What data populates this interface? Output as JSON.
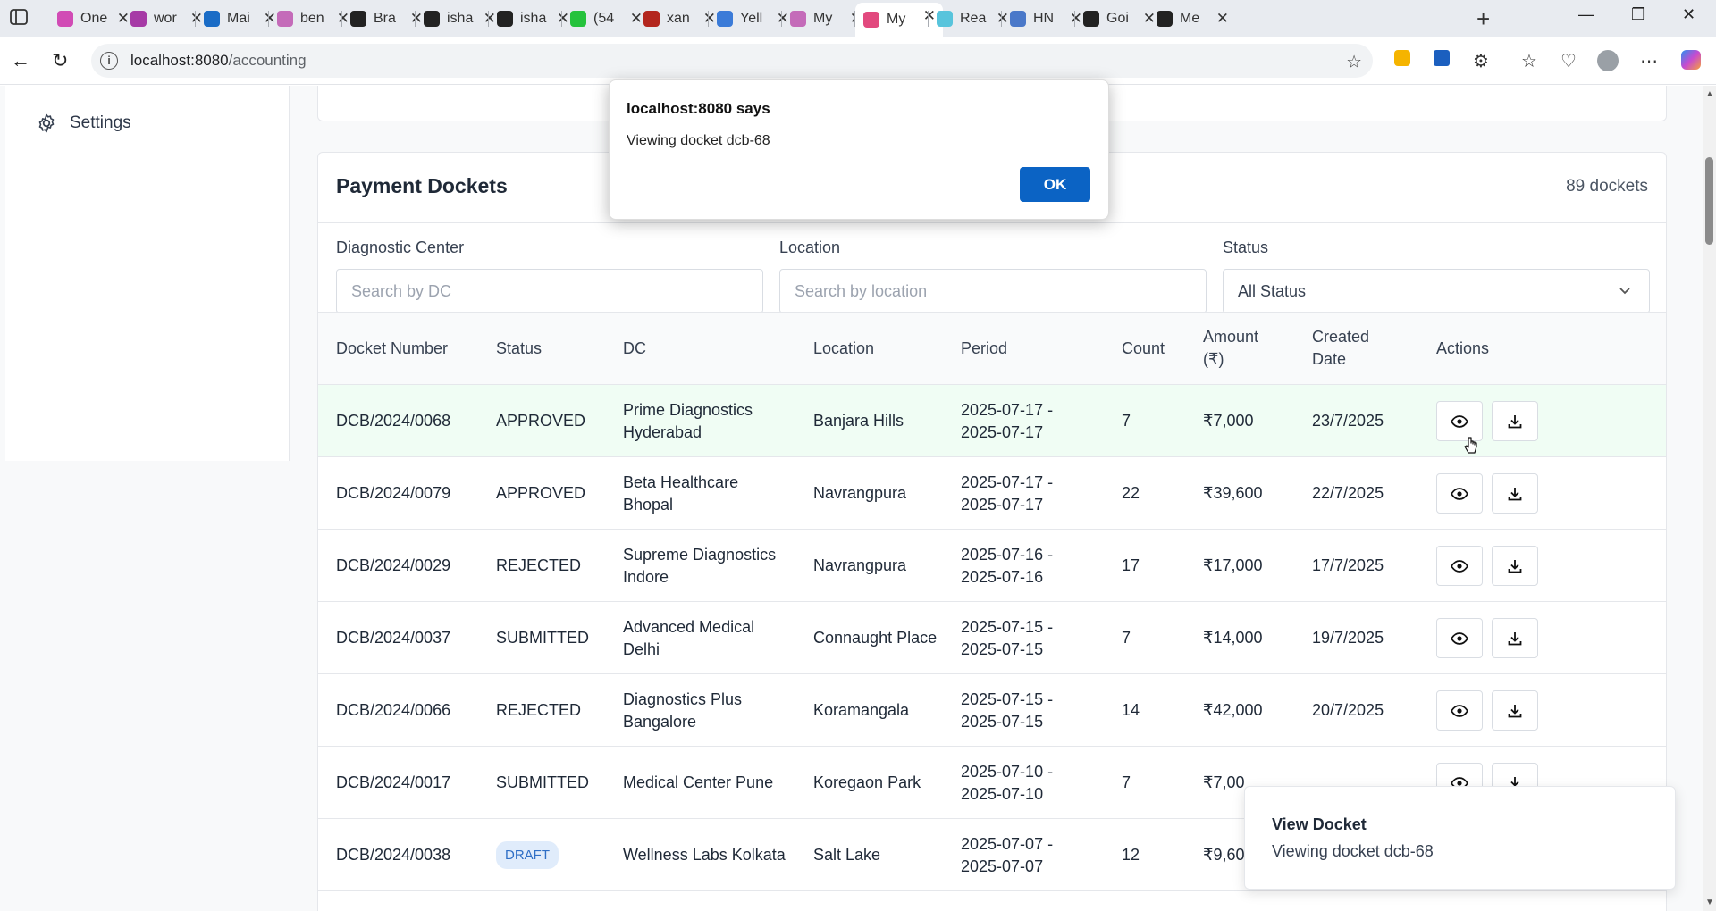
{
  "browser": {
    "tabs": [
      {
        "label": "One",
        "color": "#d14bb5",
        "icon": "copilot-icon"
      },
      {
        "label": "wor",
        "color": "#a63aa6",
        "icon": "onenote-icon"
      },
      {
        "label": "Mai",
        "color": "#1a6cc6",
        "icon": "outlook-icon"
      },
      {
        "label": "ben",
        "color": "#c46bb9",
        "icon": "loop-icon"
      },
      {
        "label": "Bra",
        "color": "#222222",
        "icon": "github-icon"
      },
      {
        "label": "isha",
        "color": "#222222",
        "icon": "github-icon"
      },
      {
        "label": "isha",
        "color": "#222222",
        "icon": "github-icon"
      },
      {
        "label": "(54",
        "color": "#25c23c",
        "icon": "whatsapp-icon"
      },
      {
        "label": "xan",
        "color": "#b3261e",
        "icon": "pdf-icon"
      },
      {
        "label": "Yell",
        "color": "#3b7bd8",
        "icon": "search-icon"
      },
      {
        "label": "My",
        "color": "#c46bb9",
        "icon": "loop-icon"
      },
      {
        "label": "My",
        "color": "#e2497e",
        "icon": "app-icon",
        "active": true
      },
      {
        "label": "Rea",
        "color": "#58c4dc",
        "icon": "react-icon"
      },
      {
        "label": "HN",
        "color": "#4a78c9",
        "icon": "hn-icon"
      },
      {
        "label": "Goi",
        "color": "#222222",
        "icon": "github-icon"
      },
      {
        "label": "Me",
        "color": "#222222",
        "icon": "openai-icon"
      }
    ],
    "url_host": "localhost:8080",
    "url_path": "/accounting"
  },
  "sidebar": {
    "settings_label": "Settings"
  },
  "dockets": {
    "title": "Payment Dockets",
    "count_label": "89 dockets",
    "filters": {
      "dc_label": "Diagnostic Center",
      "dc_placeholder": "Search by DC",
      "location_label": "Location",
      "location_placeholder": "Search by location",
      "status_label": "Status",
      "status_value": "All Status"
    },
    "columns": {
      "docket": "Docket Number",
      "status": "Status",
      "dc": "DC",
      "location": "Location",
      "period": "Period",
      "count": "Count",
      "amount": "Amount (₹)",
      "created": "Created Date",
      "actions": "Actions"
    },
    "rows": [
      {
        "docket": "DCB/2024/0068",
        "status": "APPROVED",
        "dc": "Prime Diagnostics Hyderabad",
        "location": "Banjara Hills",
        "period": "2025-07-17 - 2025-07-17",
        "count": "7",
        "amount": "₹7,000",
        "created": "23/7/2025",
        "badge": false
      },
      {
        "docket": "DCB/2024/0079",
        "status": "APPROVED",
        "dc": "Beta Healthcare Bhopal",
        "location": "Navrangpura",
        "period": "2025-07-17 - 2025-07-17",
        "count": "22",
        "amount": "₹39,600",
        "created": "22/7/2025",
        "badge": false
      },
      {
        "docket": "DCB/2024/0029",
        "status": "REJECTED",
        "dc": "Supreme Diagnostics Indore",
        "location": "Navrangpura",
        "period": "2025-07-16 - 2025-07-16",
        "count": "17",
        "amount": "₹17,000",
        "created": "17/7/2025",
        "badge": false
      },
      {
        "docket": "DCB/2024/0037",
        "status": "SUBMITTED",
        "dc": "Advanced Medical Delhi",
        "location": "Connaught Place",
        "period": "2025-07-15 - 2025-07-15",
        "count": "7",
        "amount": "₹14,000",
        "created": "19/7/2025",
        "badge": false
      },
      {
        "docket": "DCB/2024/0066",
        "status": "REJECTED",
        "dc": "Diagnostics Plus Bangalore",
        "location": "Koramangala",
        "period": "2025-07-15 - 2025-07-15",
        "count": "14",
        "amount": "₹42,000",
        "created": "20/7/2025",
        "badge": false
      },
      {
        "docket": "DCB/2024/0017",
        "status": "SUBMITTED",
        "dc": "Medical Center Pune",
        "location": "Koregaon Park",
        "period": "2025-07-10 - 2025-07-10",
        "count": "7",
        "amount": "₹7,00",
        "created": "",
        "badge": false
      },
      {
        "docket": "DCB/2024/0038",
        "status": "DRAFT",
        "dc": "Wellness Labs Kolkata",
        "location": "Salt Lake",
        "period": "2025-07-07 - 2025-07-07",
        "count": "12",
        "amount": "₹9,60",
        "created": "",
        "badge": true
      }
    ]
  },
  "alert": {
    "title": "localhost:8080 says",
    "message": "Viewing docket dcb-68",
    "ok_label": "OK"
  },
  "toast": {
    "title": "View Docket",
    "message": "Viewing docket dcb-68"
  },
  "colors": {
    "highlight_row": "#f0fdf4",
    "alert_ok": "#0b63c4",
    "draft_badge": "#2f6fc6"
  }
}
